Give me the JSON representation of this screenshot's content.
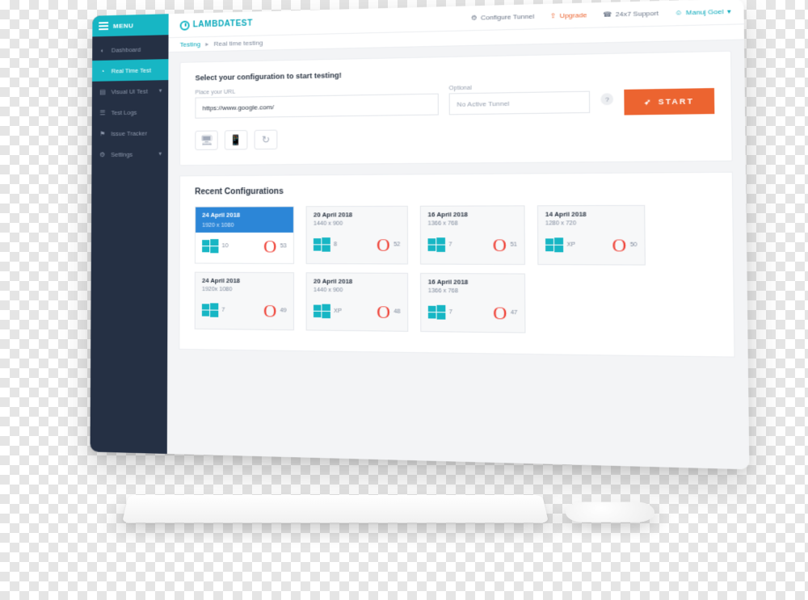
{
  "brand": {
    "name": "LAMBDATEST",
    "menu_label": "MENU"
  },
  "topbar": {
    "configure_tunnel": "Configure Tunnel",
    "upgrade": "Upgrade",
    "support": "24x7 Support",
    "user_name": "Manuj Goel"
  },
  "breadcrumb": {
    "root": "Testing",
    "current": "Real time testing"
  },
  "sidebar": {
    "items": [
      {
        "label": "Dashboard",
        "icon": "gauge-icon",
        "active": false,
        "expandable": false
      },
      {
        "label": "Real Time Test",
        "icon": "clock-icon",
        "active": true,
        "expandable": false
      },
      {
        "label": "Visual UI Test",
        "icon": "layers-icon",
        "active": false,
        "expandable": true
      },
      {
        "label": "Test Logs",
        "icon": "list-icon",
        "active": false,
        "expandable": false
      },
      {
        "label": "Issue Tracker",
        "icon": "bug-icon",
        "active": false,
        "expandable": false
      },
      {
        "label": "Settings",
        "icon": "gear-icon",
        "active": false,
        "expandable": true
      }
    ]
  },
  "config_panel": {
    "title": "Select your configuration to start testing!",
    "url_label": "Place your URL",
    "url_value": "https://www.google.com/",
    "tunnel_label": "Optional",
    "tunnel_value": "No Active Tunnel",
    "start_label": "START"
  },
  "recent": {
    "title": "Recent Configurations",
    "cards": [
      {
        "date": "24 April 2018",
        "resolution": "1920 x 1080",
        "os_ver": "10",
        "browser_ver": "53",
        "active": true
      },
      {
        "date": "20 April 2018",
        "resolution": "1440 x 900",
        "os_ver": "8",
        "browser_ver": "52",
        "active": false
      },
      {
        "date": "16 April 2018",
        "resolution": "1366 x 768",
        "os_ver": "7",
        "browser_ver": "51",
        "active": false
      },
      {
        "date": "14 April 2018",
        "resolution": "1280 x 720",
        "os_ver": "XP",
        "browser_ver": "50",
        "active": false
      },
      {
        "date": "24 April 2018",
        "resolution": "1920x 1080",
        "os_ver": "7",
        "browser_ver": "49",
        "active": false
      },
      {
        "date": "20 April 2018",
        "resolution": "1440 x 900",
        "os_ver": "XP",
        "browser_ver": "48",
        "active": false
      },
      {
        "date": "16 April 2018",
        "resolution": "1366 x 768",
        "os_ver": "7",
        "browser_ver": "47",
        "active": false
      }
    ]
  },
  "colors": {
    "accent": "#17b6c4",
    "cta": "#ec6430",
    "sidebar": "#253044",
    "card_active": "#2c86d7",
    "browser_red": "#ef4136"
  }
}
